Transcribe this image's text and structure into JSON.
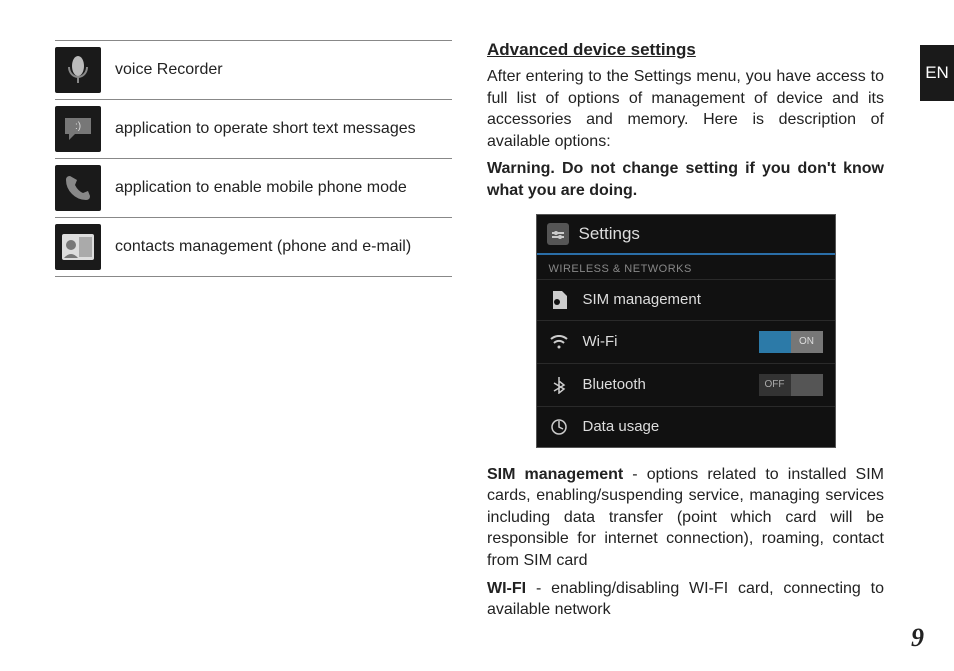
{
  "lang_tab": "EN",
  "page_number": "9",
  "apps": [
    {
      "icon": "mic-icon",
      "label": "voice Recorder"
    },
    {
      "icon": "message-icon",
      "label": "application to operate short text messages"
    },
    {
      "icon": "phone-icon",
      "label": "application to enable mobile phone mode"
    },
    {
      "icon": "contacts-icon",
      "label": "contacts management (phone and e-mail)"
    }
  ],
  "heading": "Advanced device settings",
  "intro": "After entering to the Settings menu, you have access to full list of options of management of device and its accessories and memory. Here is description of available options:",
  "warning": "Warning. Do not change setting if you don't know what you are doing.",
  "screenshot": {
    "title": "Settings",
    "section": "WIRELESS & NETWORKS",
    "rows": [
      {
        "icon": "sim-icon",
        "label": "SIM management",
        "toggle": null
      },
      {
        "icon": "wifi-icon",
        "label": "Wi-Fi",
        "toggle": "ON"
      },
      {
        "icon": "bt-icon",
        "label": "Bluetooth",
        "toggle": "OFF"
      },
      {
        "icon": "data-icon",
        "label": "Data usage",
        "toggle": null
      }
    ]
  },
  "body_sim_head": "SIM management",
  "body_sim_rest": " - options related to installed SIM cards, enabling/suspending service, managing services including data transfer (point which card will be responsible for internet connection), roaming, contact from SIM card",
  "body_wifi_head": "WI-FI",
  "body_wifi_rest": " - enabling/disabling WI-FI card, connecting to available network"
}
